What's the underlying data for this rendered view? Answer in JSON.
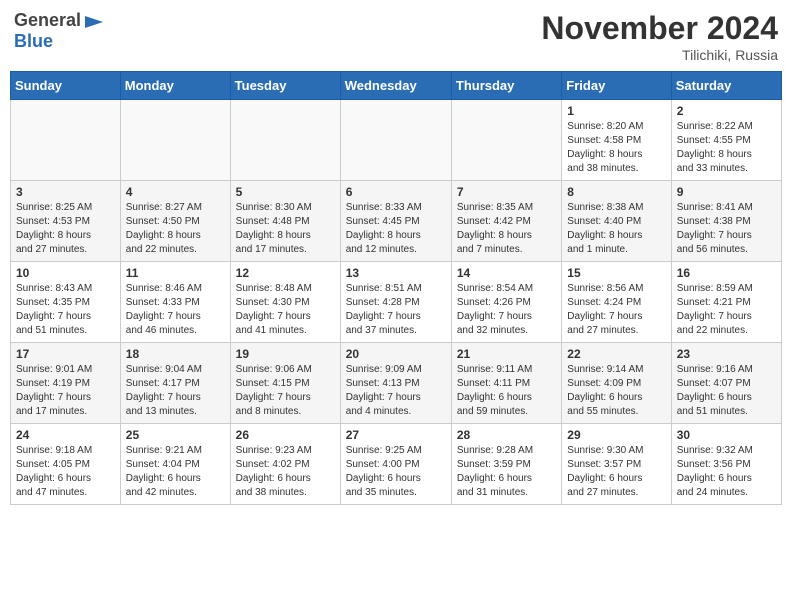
{
  "header": {
    "logo_general": "General",
    "logo_blue": "Blue",
    "month_title": "November 2024",
    "location": "Tilichiki, Russia"
  },
  "weekdays": [
    "Sunday",
    "Monday",
    "Tuesday",
    "Wednesday",
    "Thursday",
    "Friday",
    "Saturday"
  ],
  "weeks": [
    [
      {
        "day": "",
        "info": ""
      },
      {
        "day": "",
        "info": ""
      },
      {
        "day": "",
        "info": ""
      },
      {
        "day": "",
        "info": ""
      },
      {
        "day": "",
        "info": ""
      },
      {
        "day": "1",
        "info": "Sunrise: 8:20 AM\nSunset: 4:58 PM\nDaylight: 8 hours\nand 38 minutes."
      },
      {
        "day": "2",
        "info": "Sunrise: 8:22 AM\nSunset: 4:55 PM\nDaylight: 8 hours\nand 33 minutes."
      }
    ],
    [
      {
        "day": "3",
        "info": "Sunrise: 8:25 AM\nSunset: 4:53 PM\nDaylight: 8 hours\nand 27 minutes."
      },
      {
        "day": "4",
        "info": "Sunrise: 8:27 AM\nSunset: 4:50 PM\nDaylight: 8 hours\nand 22 minutes."
      },
      {
        "day": "5",
        "info": "Sunrise: 8:30 AM\nSunset: 4:48 PM\nDaylight: 8 hours\nand 17 minutes."
      },
      {
        "day": "6",
        "info": "Sunrise: 8:33 AM\nSunset: 4:45 PM\nDaylight: 8 hours\nand 12 minutes."
      },
      {
        "day": "7",
        "info": "Sunrise: 8:35 AM\nSunset: 4:42 PM\nDaylight: 8 hours\nand 7 minutes."
      },
      {
        "day": "8",
        "info": "Sunrise: 8:38 AM\nSunset: 4:40 PM\nDaylight: 8 hours\nand 1 minute."
      },
      {
        "day": "9",
        "info": "Sunrise: 8:41 AM\nSunset: 4:38 PM\nDaylight: 7 hours\nand 56 minutes."
      }
    ],
    [
      {
        "day": "10",
        "info": "Sunrise: 8:43 AM\nSunset: 4:35 PM\nDaylight: 7 hours\nand 51 minutes."
      },
      {
        "day": "11",
        "info": "Sunrise: 8:46 AM\nSunset: 4:33 PM\nDaylight: 7 hours\nand 46 minutes."
      },
      {
        "day": "12",
        "info": "Sunrise: 8:48 AM\nSunset: 4:30 PM\nDaylight: 7 hours\nand 41 minutes."
      },
      {
        "day": "13",
        "info": "Sunrise: 8:51 AM\nSunset: 4:28 PM\nDaylight: 7 hours\nand 37 minutes."
      },
      {
        "day": "14",
        "info": "Sunrise: 8:54 AM\nSunset: 4:26 PM\nDaylight: 7 hours\nand 32 minutes."
      },
      {
        "day": "15",
        "info": "Sunrise: 8:56 AM\nSunset: 4:24 PM\nDaylight: 7 hours\nand 27 minutes."
      },
      {
        "day": "16",
        "info": "Sunrise: 8:59 AM\nSunset: 4:21 PM\nDaylight: 7 hours\nand 22 minutes."
      }
    ],
    [
      {
        "day": "17",
        "info": "Sunrise: 9:01 AM\nSunset: 4:19 PM\nDaylight: 7 hours\nand 17 minutes."
      },
      {
        "day": "18",
        "info": "Sunrise: 9:04 AM\nSunset: 4:17 PM\nDaylight: 7 hours\nand 13 minutes."
      },
      {
        "day": "19",
        "info": "Sunrise: 9:06 AM\nSunset: 4:15 PM\nDaylight: 7 hours\nand 8 minutes."
      },
      {
        "day": "20",
        "info": "Sunrise: 9:09 AM\nSunset: 4:13 PM\nDaylight: 7 hours\nand 4 minutes."
      },
      {
        "day": "21",
        "info": "Sunrise: 9:11 AM\nSunset: 4:11 PM\nDaylight: 6 hours\nand 59 minutes."
      },
      {
        "day": "22",
        "info": "Sunrise: 9:14 AM\nSunset: 4:09 PM\nDaylight: 6 hours\nand 55 minutes."
      },
      {
        "day": "23",
        "info": "Sunrise: 9:16 AM\nSunset: 4:07 PM\nDaylight: 6 hours\nand 51 minutes."
      }
    ],
    [
      {
        "day": "24",
        "info": "Sunrise: 9:18 AM\nSunset: 4:05 PM\nDaylight: 6 hours\nand 47 minutes."
      },
      {
        "day": "25",
        "info": "Sunrise: 9:21 AM\nSunset: 4:04 PM\nDaylight: 6 hours\nand 42 minutes."
      },
      {
        "day": "26",
        "info": "Sunrise: 9:23 AM\nSunset: 4:02 PM\nDaylight: 6 hours\nand 38 minutes."
      },
      {
        "day": "27",
        "info": "Sunrise: 9:25 AM\nSunset: 4:00 PM\nDaylight: 6 hours\nand 35 minutes."
      },
      {
        "day": "28",
        "info": "Sunrise: 9:28 AM\nSunset: 3:59 PM\nDaylight: 6 hours\nand 31 minutes."
      },
      {
        "day": "29",
        "info": "Sunrise: 9:30 AM\nSunset: 3:57 PM\nDaylight: 6 hours\nand 27 minutes."
      },
      {
        "day": "30",
        "info": "Sunrise: 9:32 AM\nSunset: 3:56 PM\nDaylight: 6 hours\nand 24 minutes."
      }
    ]
  ]
}
